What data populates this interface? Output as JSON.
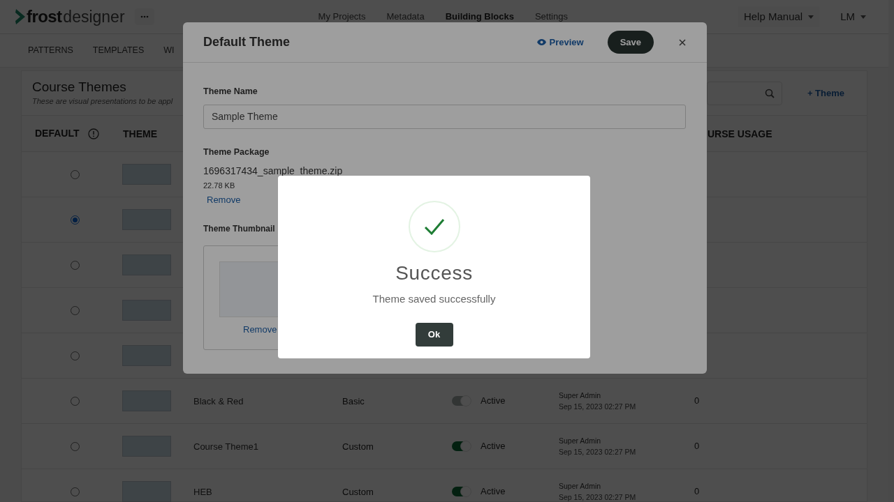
{
  "header": {
    "logo_bold": "frost",
    "logo_light": "designer",
    "nav": [
      {
        "label": "My Projects",
        "selected": false
      },
      {
        "label": "Metadata",
        "selected": false
      },
      {
        "label": "Building Blocks",
        "selected": true
      },
      {
        "label": "Settings",
        "selected": false
      }
    ],
    "help": "Help Manual",
    "user": "LM"
  },
  "subnav": [
    "PATTERNS",
    "TEMPLATES",
    "WI"
  ],
  "card": {
    "title": "Course Themes",
    "subtitle": "These are visual presentations to be appl",
    "add_button": "+ Theme"
  },
  "table": {
    "columns": [
      {
        "label": "DEFAULT",
        "kind": "default"
      },
      {
        "label": "THEME",
        "kind": "theme"
      },
      {
        "label": "URSE USAGE",
        "kind": "usage"
      }
    ],
    "rows": [
      {
        "selected": false
      },
      {
        "selected": true
      },
      {
        "selected": false
      },
      {
        "selected": false
      },
      {
        "selected": false
      },
      {
        "selected": false,
        "name": "Black & Red",
        "type": "Basic",
        "status": {
          "label": "Active",
          "on": true,
          "disabled": true
        },
        "modified_by": "Super Admin",
        "modified_at": "Sep 15, 2023 02:27 PM",
        "usage": "0"
      },
      {
        "selected": false,
        "name": "Course Theme1",
        "type": "Custom",
        "status": {
          "label": "Active",
          "on": true,
          "disabled": false
        },
        "modified_by": "Super Admin",
        "modified_at": "Sep 15, 2023 02:27 PM",
        "usage": "0"
      },
      {
        "selected": false,
        "name": "HEB",
        "type": "Custom",
        "status": {
          "label": "Active",
          "on": true,
          "disabled": false
        },
        "modified_by": "Super Admin",
        "modified_at": "Sep 15, 2023 02:27 PM",
        "usage": "0"
      }
    ]
  },
  "theme_modal": {
    "title": "Default Theme",
    "preview": "Preview",
    "save": "Save",
    "name_label": "Theme Name",
    "name_value": "Sample Theme",
    "package_label": "Theme Package",
    "file_name": "1696317434_sample_theme.zip",
    "file_size": "22.78 KB",
    "file_remove": "Remove",
    "thumbnail_label": "Theme Thumbnail",
    "thumbnail_remove": "Remove"
  },
  "success": {
    "title": "Success",
    "message": "Theme saved successfully",
    "ok": "Ok"
  }
}
